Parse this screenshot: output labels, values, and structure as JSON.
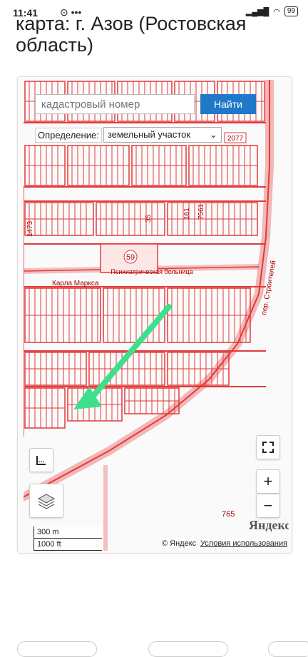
{
  "status": {
    "time": "11:41",
    "battery": "99"
  },
  "page": {
    "title": "карта: г. Азов (Ростовская область)"
  },
  "search": {
    "placeholder": "кадастровый номер",
    "button": "Найти"
  },
  "definition": {
    "label": "Определение:",
    "value": "земельный участок"
  },
  "map_labels": {
    "road_2077": "2077",
    "parcel_59": "59",
    "num_35": "35",
    "num_161": "161",
    "num_7561": "7561",
    "num_1473": "1473",
    "num_765": "765",
    "street_stroiteley": "пер. Строителей",
    "street_marksa": "Карла Маркса",
    "hospital_name": "Психиатрическая больница"
  },
  "scale": {
    "metric": "300 m",
    "imperial": "1000 ft"
  },
  "attribution": {
    "copyright": "© Яндекс",
    "terms": "Условия использования",
    "logo": "Яндекс"
  },
  "controls": {
    "zoom_in": "+",
    "zoom_out": "−"
  },
  "colors": {
    "parcel_line": "#e23a3a",
    "arrow": "#3de08a",
    "search_button": "#1f78c8"
  },
  "icons": [
    "dots-icon",
    "signal-icon",
    "wifi-icon",
    "battery-icon",
    "ruler-icon",
    "layers-icon",
    "fullscreen-icon"
  ]
}
